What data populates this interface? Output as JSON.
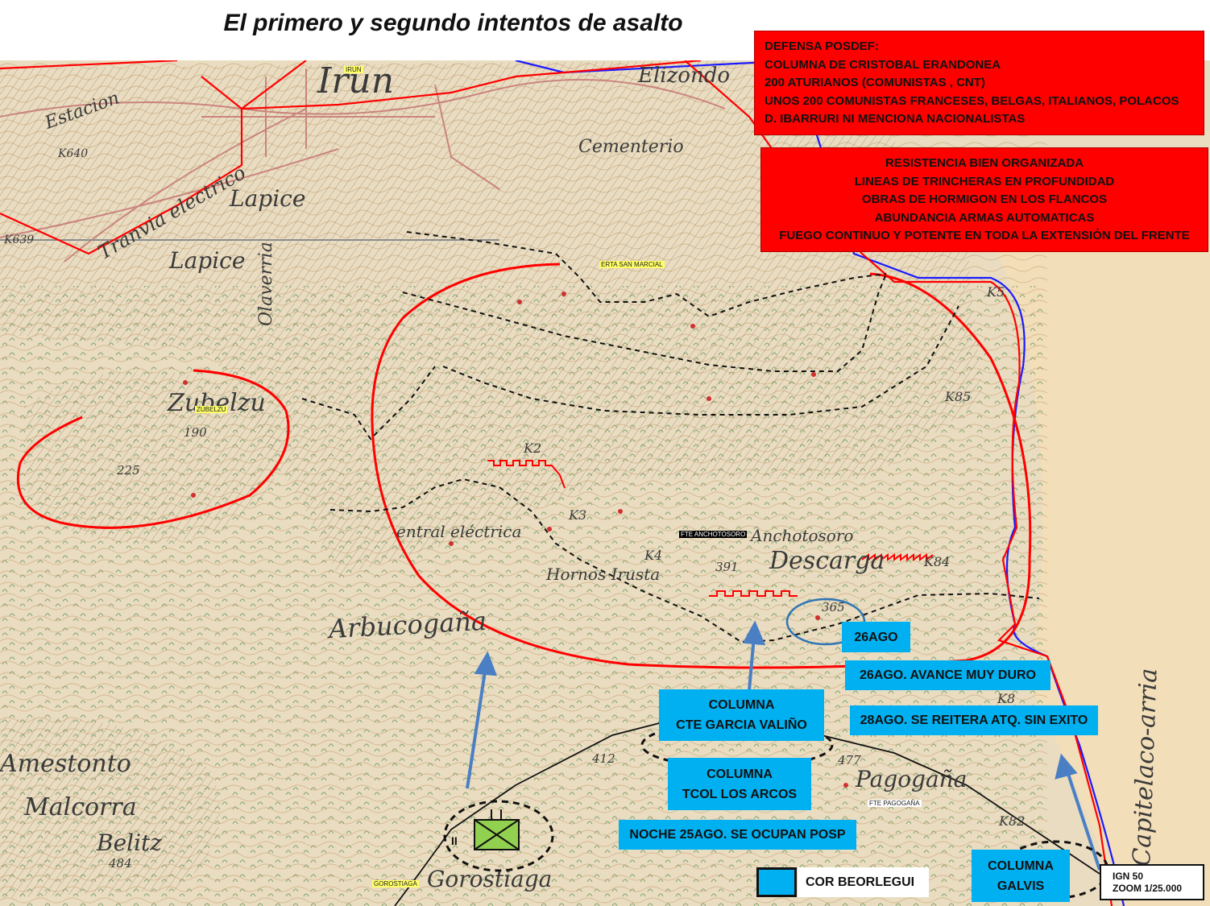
{
  "title": "El primero y segundo intentos de asalto",
  "defense_box": {
    "lines": [
      "DEFENSA POSDEF:",
      "COLUMNA DE CRISTOBAL ERANDONEA",
      "200 ATURIANOS (COMUNISTAS , CNT)",
      "UNOS 200 COMUNISTAS FRANCESES, BELGAS, ITALIANOS, POLACOS",
      "D. IBARRURI NI MENCIONA NACIONALISTAS"
    ]
  },
  "resistance_box": {
    "lines": [
      "RESISTENCIA BIEN ORGANIZADA",
      "LINEAS  DE TRINCHERAS EN PROFUNDIDAD",
      "OBRAS DE HORMIGON EN LOS FLANCOS",
      "ABUNDANCIA ARMAS AUTOMATICAS",
      "FUEGO CONTINUO Y POTENTE EN TODA LA EXTENSIÓN DEL FRENTE"
    ]
  },
  "callouts": {
    "ago26": "26AGO",
    "ago26_advance": "26AGO. AVANCE MUY DURO",
    "ago28": "28AGO. SE REITERA ATQ. SIN EXITO",
    "night25": "NOCHE 25AGO. SE OCUPAN POSP",
    "garcia_valino_line1": "COLUMNA",
    "garcia_valino_line2": "CTE GARCIA VALIÑO",
    "los_arcos_line1": "COLUMNA",
    "los_arcos_line2": "TCOL LOS ARCOS",
    "galvis_line1": "COLUMNA",
    "galvis_line2": "GALVIS"
  },
  "legend": {
    "label": "COR BEORLEGUI",
    "swatch_color": "#00b0f0"
  },
  "scale": {
    "line1": "IGN 50",
    "line2": "ZOOM  1/25.000"
  },
  "unit_marker": {
    "label": "II",
    "symbol": "infantry-battalion-icon",
    "fill_color": "#92d050"
  },
  "place_tags": {
    "irun": "IRUN",
    "erta_san_marcial": "ERTA SAN MARCIAL",
    "zubelzu": "ZUBELZU",
    "fte_anchotosoro": "FTE ANCHOTOSORO",
    "fte_pagogana": "FTE PAGOGAÑA",
    "gorostiaga": "GOROSTIAGA"
  },
  "map_labels": {
    "irun": "Irun",
    "lapice1": "Lapice",
    "lapice2": "Lapice",
    "olaverria": "Olaverria",
    "zubelzu": "Zubelzu",
    "arbucogana": "Arbucogaña",
    "descarga": "Descarga",
    "anchotosoro": "Anchotosoro",
    "pagogana": "Pagogaña",
    "amestonto": "Amestonto",
    "malcorra": "Malcorra",
    "belitz": "Belitz",
    "gorostiaga": "Gorostiaga",
    "cementerio": "Cementerio",
    "elizondo": "Elizondo",
    "capitelaco": "Capitelaco-arria",
    "estacion": "Estacion",
    "tranvia": "Tranvia electrico",
    "central": "entral eléctrica",
    "hornos": "Hornos Irusta",
    "k2": "K2",
    "k3": "K3",
    "k4": "K4",
    "k5": "K5",
    "k8": "K8",
    "k82": "K82",
    "k84": "K84",
    "k85": "K85",
    "k639": "K639",
    "k640": "K640",
    "h190": "190",
    "h225": "225",
    "h391": "391",
    "h365": "365",
    "h412": "412",
    "h477": "477",
    "h484": "484"
  },
  "colors": {
    "front_line": "#ff0000",
    "trench_line": "#111111",
    "border_river": "#1a1aff",
    "attack_arrow": "#4a7fc4",
    "map_paper": "#e9dcc0",
    "red_box": "#ff0000",
    "blue_box": "#00b0f0"
  }
}
